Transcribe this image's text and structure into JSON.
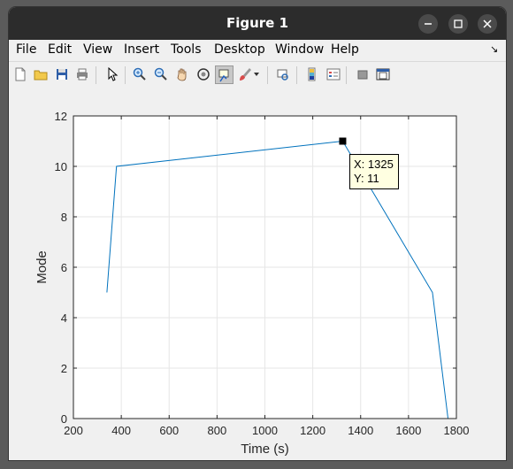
{
  "window": {
    "title": "Figure 1"
  },
  "menu": [
    "File",
    "Edit",
    "View",
    "Insert",
    "Tools",
    "Desktop",
    "Window",
    "Help"
  ],
  "toolbar": {
    "icons": [
      "new-figure-icon",
      "open-file-icon",
      "save-icon",
      "print-icon",
      "edit-plot-arrow-icon",
      "zoom-in-icon",
      "zoom-out-icon",
      "pan-hand-icon",
      "rotate-3d-icon",
      "data-cursor-icon",
      "brush-icon",
      "link-plot-icon",
      "colorbar-icon",
      "legend-icon",
      "hide-plot-tools-icon",
      "show-plot-tools-icon"
    ]
  },
  "datatip": {
    "x_label": "X: 1325",
    "y_label": "Y: 11"
  },
  "chart_data": {
    "type": "line",
    "xlabel": "Time (s)",
    "ylabel": "Mode",
    "xlim": [
      200,
      1800
    ],
    "ylim": [
      0,
      12
    ],
    "xticks": [
      200,
      400,
      600,
      800,
      1000,
      1200,
      1400,
      1600,
      1800
    ],
    "yticks": [
      0,
      2,
      4,
      6,
      8,
      10,
      12
    ],
    "grid": true,
    "series": [
      {
        "x": [
          340,
          380,
          1325,
          1700,
          1765
        ],
        "y": [
          5,
          10,
          11,
          5,
          0
        ],
        "color": "#0072bd"
      }
    ],
    "marker_point": {
      "x": 1325,
      "y": 11
    }
  }
}
